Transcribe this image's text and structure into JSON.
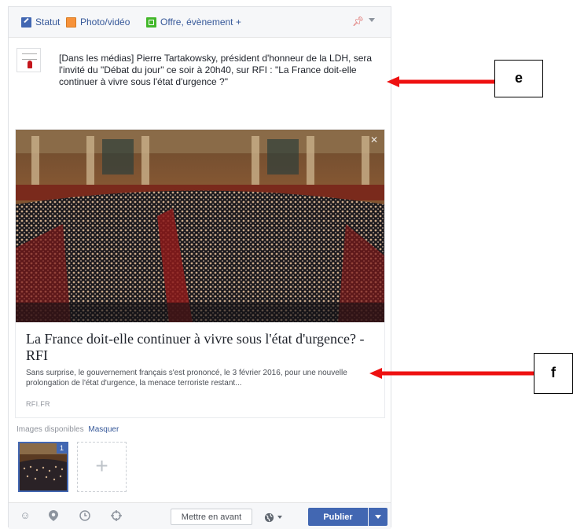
{
  "composer": {
    "tabs": [
      {
        "label": "Statut",
        "icon": "status-pencil-icon"
      },
      {
        "label": "Photo/vidéo",
        "icon": "photo-icon"
      },
      {
        "label": "Offre, évènement +",
        "icon": "offer-icon"
      }
    ],
    "post_text": "[Dans les médias] Pierre Tartakowsky, président d'honneur de la LDH, sera l'invité du \"Débat du jour\" ce soir à 20h40, sur RFI : \"La France doit-elle continuer à vivre sous l'état d'urgence ?\"",
    "preview": {
      "title": "La France doit-elle continuer à vivre sous l'état d'urgence? - RFI",
      "description": "Sans surprise, le gouvernement français s'est prononcé, le 3 février 2016, pour une nouvelle prolongation de l'état d'urgence, la menace terroriste restant...",
      "domain": "RFI.FR"
    },
    "images": {
      "label": "Images disponibles",
      "hide_label": "Masquer",
      "badge": "1",
      "add_symbol": "+"
    },
    "toolbar": {
      "feature_label": "Mettre en avant",
      "publish_label": "Publier"
    }
  },
  "annotations": {
    "e": "e",
    "f": "f"
  },
  "colors": {
    "brand": "#4267b2",
    "link": "#365899",
    "annotation_arrow": "#ee1111"
  }
}
